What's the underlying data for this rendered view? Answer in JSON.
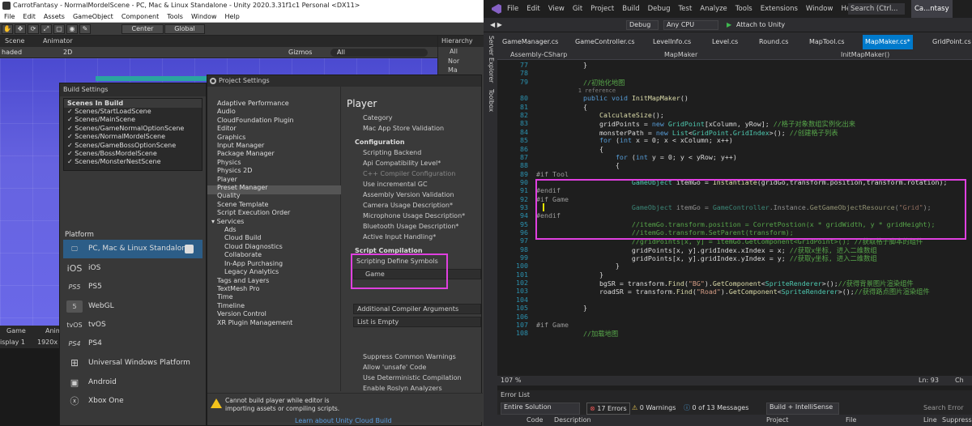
{
  "unity": {
    "title": "CarrotFantasy - NormalMordelScene - PC, Mac & Linux Standalone - Unity 2020.3.31f1c1 Personal <DX11>",
    "menu": [
      "File",
      "Edit",
      "Assets",
      "GameObject",
      "Component",
      "Tools",
      "Window",
      "Help"
    ],
    "toolbar": {
      "center": "Center",
      "global": "Global"
    },
    "scene_tabs": {
      "scene": "Scene",
      "animator": "Animator"
    },
    "scene_bar": {
      "shaded": "haded",
      "mode2d": "2D",
      "gizmos": "Gizmos",
      "search": "All"
    },
    "hierarchy": {
      "title": "Hierarchy",
      "search": "All",
      "items": [
        "Nor",
        "Ma"
      ]
    },
    "game_tabs": {
      "game": "Game",
      "anim": "Anim",
      "display": "isplay 1",
      "res": "1920x"
    },
    "build": {
      "title": "Build Settings",
      "scenes_header": "Scenes In Build",
      "scenes": [
        "Scenes/StartLoadScene",
        "Scenes/MainScene",
        "Scenes/GameNormalOptionScene",
        "Scenes/NormalMordelScene",
        "Scenes/GameBossOptionScene",
        "Scenes/BossMordelScene",
        "Scenes/MonsterNestScene"
      ],
      "platform_header": "Platform",
      "platforms": [
        {
          "icon": "monitor",
          "label": "PC, Mac & Linux Standalone"
        },
        {
          "icon": "iOS",
          "label": "iOS"
        },
        {
          "icon": "PS5",
          "label": "PS5"
        },
        {
          "icon": "5",
          "label": "WebGL"
        },
        {
          "icon": "tvOS",
          "label": "tvOS"
        },
        {
          "icon": "PS4",
          "label": "PS4"
        },
        {
          "icon": "win",
          "label": "Universal Windows Platform"
        },
        {
          "icon": "andr",
          "label": "Android"
        },
        {
          "icon": "X",
          "label": "Xbox One"
        }
      ]
    },
    "project_settings": {
      "title": "Project Settings",
      "nav": [
        "Adaptive Performance",
        "Audio",
        "CloudFoundation Plugin",
        "Editor",
        "Graphics",
        "Input Manager",
        "Package Manager",
        "Physics",
        "Physics 2D",
        "Player",
        "Preset Manager",
        "Quality",
        "Scene Template",
        "Script Execution Order"
      ],
      "services": "Services",
      "services_items": [
        "Ads",
        "Cloud Build",
        "Cloud Diagnostics",
        "Collaborate",
        "In-App Purchasing",
        "Legacy Analytics"
      ],
      "nav_tail": [
        "Tags and Layers",
        "TextMesh Pro",
        "Time",
        "Timeline",
        "Version Control",
        "XR Plugin Management"
      ],
      "player_title": "Player",
      "rows_top": [
        "Category",
        "Mac App Store Validation"
      ],
      "configuration": "Configuration",
      "config_rows": [
        "Scripting Backend",
        "Api Compatibility Level*",
        "C++ Compiler Configuration",
        "Use incremental GC",
        "Assembly Version Validation",
        "Camera Usage Description*",
        "Microphone Usage Description*",
        "Bluetooth Usage Description*",
        "Active Input Handling*"
      ],
      "script_compilation": "Script Compilation",
      "scripting_define": "Scripting Define Symbols",
      "define_value": "Game",
      "additional_args": "Additional Compiler Arguments",
      "list_empty": "List is Empty",
      "bottom_rows": [
        "Suppress Common Warnings",
        "Allow 'unsafe' Code",
        "Use Deterministic Compilation",
        "Enable Roslyn Analyzers"
      ],
      "warning": "Cannot build player while editor is importing assets or compiling scripts.",
      "learn_more": "Learn about Unity Cloud Build"
    }
  },
  "vs": {
    "menu": [
      "File",
      "Edit",
      "View",
      "Git",
      "Project",
      "Build",
      "Debug",
      "Test",
      "Analyze",
      "Tools",
      "Extensions",
      "Window",
      "Help"
    ],
    "search": "Search (Ctrl...",
    "project_name": "Ca...ntasy",
    "toolbar": {
      "config": "Debug",
      "platform": "Any CPU",
      "attach": "Attach to Unity"
    },
    "side": [
      "Server Explorer",
      "Toolbox"
    ],
    "tabs": [
      "GameManager.cs",
      "GameController.cs",
      "LevelInfo.cs",
      "Level.cs",
      "Round.cs",
      "MapTool.cs",
      "MapMaker.cs*",
      "GridPoint.cs"
    ],
    "nav": {
      "assembly": "Assembly-CSharp",
      "class": "MapMaker",
      "method": "InitMapMaker()"
    },
    "code_lines": [
      {
        "n": "77",
        "t": "        }"
      },
      {
        "n": "78",
        "t": ""
      },
      {
        "n": "79",
        "t": "        //初始化地图"
      },
      {
        "n": "",
        "t": "        1 reference"
      },
      {
        "n": "80",
        "t": "        public void InitMapMaker()"
      },
      {
        "n": "81",
        "t": "        {"
      },
      {
        "n": "82",
        "t": "            CalculateSize();"
      },
      {
        "n": "83",
        "t": "            gridPoints = new GridPoint[xColumn, yRow]; //格子对象数组实例化出来"
      },
      {
        "n": "84",
        "t": "            monsterPath = new List<GridPoint.GridIndex>(); //创建格子列表"
      },
      {
        "n": "85",
        "t": "            for (int x = 0; x < xColumn; x++)"
      },
      {
        "n": "86",
        "t": "            {"
      },
      {
        "n": "87",
        "t": "                for (int y = 0; y < yRow; y++)"
      },
      {
        "n": "88",
        "t": "                {"
      },
      {
        "n": "89",
        "t": "#if Tool"
      },
      {
        "n": "90",
        "t": "                    GameObject itemGo = Instantiate(gridGo,transform.position,transform.rotation);"
      },
      {
        "n": "91",
        "t": "#endif"
      },
      {
        "n": "92",
        "t": "#if Game"
      },
      {
        "n": "93",
        "t": "                    GameObject itemGo = GameController.Instance.GetGameObjectResource(\"Grid\");"
      },
      {
        "n": "94",
        "t": "#endif"
      },
      {
        "n": "95",
        "t": "                    //itemGo.transform.position = CorretPostion(x * gridWidth, y * gridHeight);"
      },
      {
        "n": "96",
        "t": "                    //itemGo.transform.SetParent(transform);"
      },
      {
        "n": "97",
        "t": "                    //gridPoints[x, y] = itemGo.GetComponent<GridPoint>(); //获取格子脚本的组件"
      },
      {
        "n": "98",
        "t": "                    gridPoints[x, y].gridIndex.xIndex = x; //获取x坐标, 进入二维数组"
      },
      {
        "n": "99",
        "t": "                    gridPoints[x, y].gridIndex.yIndex = y; //获取y坐标, 进入二维数组"
      },
      {
        "n": "100",
        "t": "                }"
      },
      {
        "n": "101",
        "t": "            }"
      },
      {
        "n": "102",
        "t": "            bgSR = transform.Find(\"BG\").GetComponent<SpriteRenderer>();//获得背景图片渲染组件"
      },
      {
        "n": "103",
        "t": "            roadSR = transform.Find(\"Road\").GetComponent<SpriteRenderer>();//获得路点图片渲染组件"
      },
      {
        "n": "104",
        "t": ""
      },
      {
        "n": "105",
        "t": "        }"
      },
      {
        "n": "106",
        "t": ""
      },
      {
        "n": "107",
        "t": "#if Game"
      },
      {
        "n": "108",
        "t": "        //加载地图"
      }
    ],
    "status": {
      "zoom": "107 %",
      "line": "Ln: 93",
      "ch": "Ch"
    },
    "error_list": {
      "title": "Error List",
      "scope": "Entire Solution",
      "errors": "17 Errors",
      "warnings": "0 Warnings",
      "messages": "0 of 13 Messages",
      "filter": "Build + IntelliSense",
      "search": "Search Error List",
      "cols": [
        "Code",
        "Description",
        "Project",
        "File",
        "Line",
        "Suppress"
      ]
    }
  }
}
